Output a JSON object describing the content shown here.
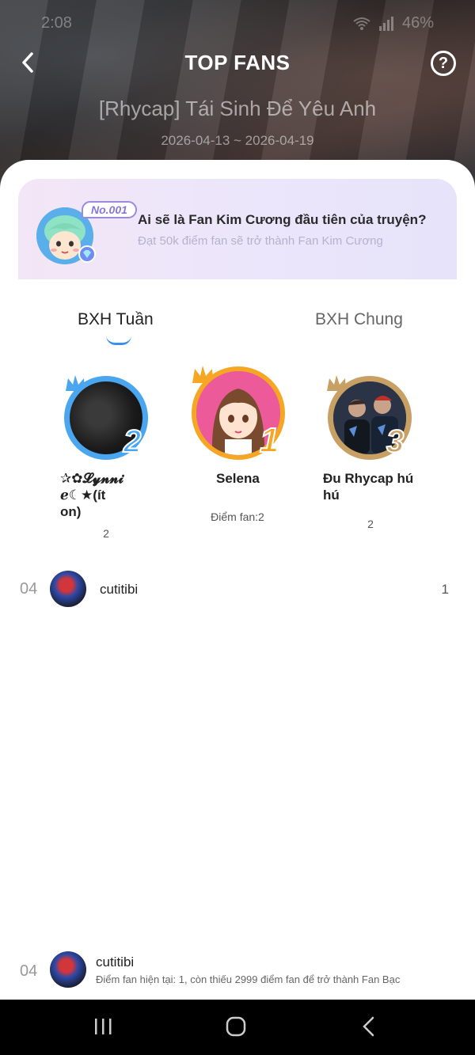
{
  "status_bar": {
    "time": "2:08",
    "battery": "46%"
  },
  "header": {
    "title": "TOP FANS",
    "book_title": "[Rhycap] Tái Sinh Để Yêu Anh",
    "date_range": "2026-04-13 ~ 2026-04-19"
  },
  "banner": {
    "badge": "No.001",
    "title": "Ai sẽ là Fan Kim Cương đầu tiên của truyện?",
    "subtitle": "Đạt 50k điểm fan sẽ trở thành Fan Kim Cương"
  },
  "tabs": [
    {
      "label": "BXH Tuần",
      "active": true
    },
    {
      "label": "BXH Chung",
      "active": false
    }
  ],
  "podium": {
    "first": {
      "rank": "1",
      "name": "Selena",
      "score": "Điểm fan:2",
      "ring_color": "#f5a623"
    },
    "second": {
      "rank": "2",
      "name_line1": "✰✿𝓛𝔂𝓷𝓷𝓲",
      "name_line2": "ℯ☾★(ít",
      "name_line3": "on)",
      "score": "2",
      "ring_color": "#4aa6ee"
    },
    "third": {
      "rank": "3",
      "name_line1": "Đu Rhycap hú",
      "name_line2": "hú",
      "score": "2",
      "ring_color": "#c9a064"
    }
  },
  "list": [
    {
      "rank": "04",
      "name": "cutitibi",
      "score": "1"
    }
  ],
  "my_rank": {
    "rank": "04",
    "name": "cutitibi",
    "description": "Điểm fan hiện tại: 1, còn thiếu 2999 điểm fan để trở thành Fan Bạc"
  },
  "icons": {
    "back": "chevron-left-icon",
    "help": "question-circle-icon",
    "nav_recent": "recent-apps-icon",
    "nav_home": "home-icon",
    "nav_back": "back-icon"
  }
}
